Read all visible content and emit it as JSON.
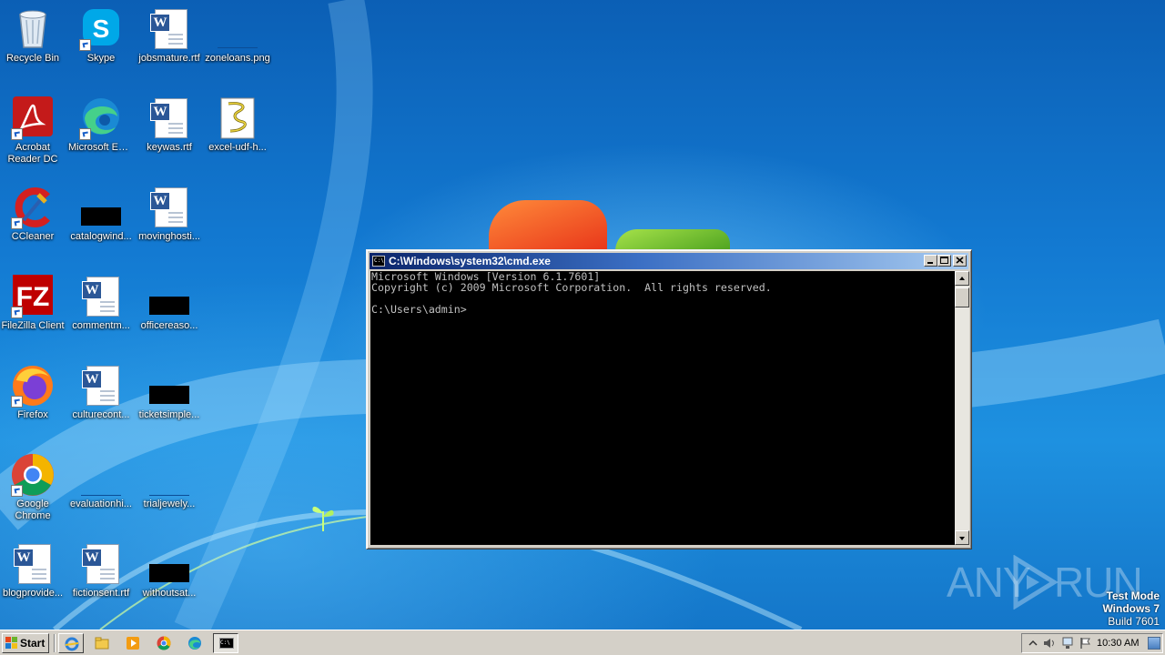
{
  "desktop": {
    "icons": [
      {
        "label": "Recycle Bin",
        "icon": "recycle-bin-icon"
      },
      {
        "label": "Skype",
        "icon": "skype-icon"
      },
      {
        "label": "jobsmature.rtf",
        "icon": "word-document-icon"
      },
      {
        "label": "zoneloans.png",
        "icon": "image-file-icon"
      },
      {
        "label": "Acrobat Reader DC",
        "icon": "acrobat-reader-icon"
      },
      {
        "label": "Microsoft Edge",
        "icon": "edge-icon"
      },
      {
        "label": "keywas.rtf",
        "icon": "word-document-icon"
      },
      {
        "label": "excel-udf-h...",
        "icon": "script-file-icon"
      },
      {
        "label": "CCleaner",
        "icon": "ccleaner-icon"
      },
      {
        "label": "catalogwind...",
        "icon": "image-file-icon"
      },
      {
        "label": "movinghosti...",
        "icon": "word-document-icon"
      },
      {
        "label": "FileZilla Client",
        "icon": "filezilla-icon"
      },
      {
        "label": "commentm...",
        "icon": "word-document-icon"
      },
      {
        "label": "officereaso...",
        "icon": "image-file-icon"
      },
      {
        "label": "Firefox",
        "icon": "firefox-icon"
      },
      {
        "label": "culturecont...",
        "icon": "word-document-icon"
      },
      {
        "label": "ticketsimple...",
        "icon": "image-file-icon"
      },
      {
        "label": "Google Chrome",
        "icon": "chrome-icon"
      },
      {
        "label": "evaluationhi...",
        "icon": "image-file-icon"
      },
      {
        "label": "trialjewely...",
        "icon": "image-file-icon"
      },
      {
        "label": "blogprovide...",
        "icon": "word-document-icon"
      },
      {
        "label": "fictionsent.rtf",
        "icon": "word-document-icon"
      },
      {
        "label": "withoutsat...",
        "icon": "image-file-icon"
      }
    ]
  },
  "cmd": {
    "title": "C:\\Windows\\system32\\cmd.exe",
    "lines": [
      "Microsoft Windows [Version 6.1.7601]",
      "Copyright (c) 2009 Microsoft Corporation.  All rights reserved.",
      "",
      "C:\\Users\\admin>"
    ]
  },
  "watermark": {
    "brand_left": "ANY",
    "brand_right": "RUN",
    "test_mode": "Test Mode",
    "os_name": "Windows 7",
    "build": "Build 7601"
  },
  "taskbar": {
    "start_label": "Start",
    "clock": "10:30 AM",
    "quick_launch": [
      "internet-explorer-icon",
      "file-explorer-icon",
      "media-player-icon",
      "chrome-icon",
      "edge-icon",
      "cmd-icon"
    ]
  },
  "colors": {
    "titlebar_start": "#0a246a",
    "titlebar_end": "#a6caf0",
    "console_bg": "#000000",
    "console_text": "#c0c0c0",
    "classic_face": "#d4d0c8"
  }
}
